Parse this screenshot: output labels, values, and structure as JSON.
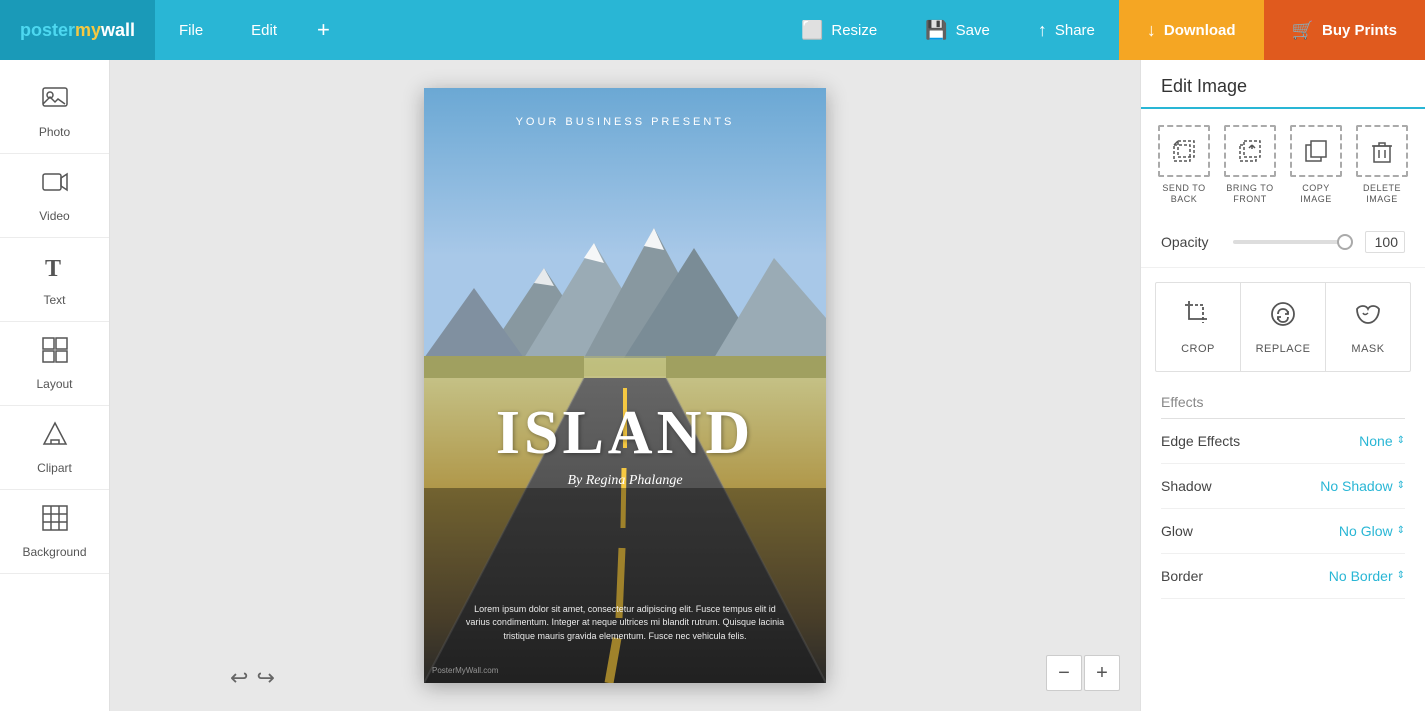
{
  "app": {
    "logo": "postermy wall",
    "logo_poster": "poster",
    "logo_my": "my",
    "logo_wall": "wall"
  },
  "topnav": {
    "file_label": "File",
    "edit_label": "Edit",
    "add_label": "+",
    "resize_label": "Resize",
    "save_label": "Save",
    "share_label": "Share",
    "download_label": "Download",
    "buy_prints_label": "Buy Prints"
  },
  "sidebar": {
    "items": [
      {
        "id": "photo",
        "label": "Photo",
        "icon": "🖼"
      },
      {
        "id": "video",
        "label": "Video",
        "icon": "▶"
      },
      {
        "id": "text",
        "label": "Text",
        "icon": "T"
      },
      {
        "id": "layout",
        "label": "Layout",
        "icon": "⊞"
      },
      {
        "id": "clipart",
        "label": "Clipart",
        "icon": "△"
      },
      {
        "id": "background",
        "label": "Background",
        "icon": "▦"
      }
    ]
  },
  "poster": {
    "top_text": "YOUR BUSINESS PRESENTS",
    "title": "ISLAND",
    "subtitle": "By Regina Phalange",
    "body_text": "Lorem ipsum dolor sit amet, consectetur adipiscing elit. Fusce tempus elit id varius condimentum. Integer at neque ultrices mi blandit rutrum. Quisque lacinia tristique mauris gravida elementum. Fusce nec vehicula felis.",
    "watermark": "PosterMyWall.com"
  },
  "right_panel": {
    "title": "Edit Image",
    "edit_actions": [
      {
        "id": "send-to-back",
        "label": "SEND TO\nBACK",
        "icon": "send_back"
      },
      {
        "id": "bring-to-front",
        "label": "BRING TO\nFRONT",
        "icon": "bring_front"
      },
      {
        "id": "copy-image",
        "label": "COPY\nIMAGE",
        "icon": "copy"
      },
      {
        "id": "delete-image",
        "label": "DELETE\nIMAGE",
        "icon": "delete"
      }
    ],
    "opacity_label": "Opacity",
    "opacity_value": "100",
    "actions": [
      {
        "id": "crop",
        "label": "CROP",
        "icon": "crop"
      },
      {
        "id": "replace",
        "label": "REPLACE",
        "icon": "replace"
      },
      {
        "id": "mask",
        "label": "MASK",
        "icon": "mask"
      }
    ],
    "effects_title": "Effects",
    "effects": [
      {
        "id": "edge-effects",
        "label": "Edge Effects",
        "value": "None"
      },
      {
        "id": "shadow",
        "label": "Shadow",
        "value": "No Shadow"
      },
      {
        "id": "glow",
        "label": "Glow",
        "value": "No Glow"
      },
      {
        "id": "border",
        "label": "Border",
        "value": "No Border"
      }
    ]
  },
  "zoom": {
    "minus": "−",
    "plus": "+"
  }
}
